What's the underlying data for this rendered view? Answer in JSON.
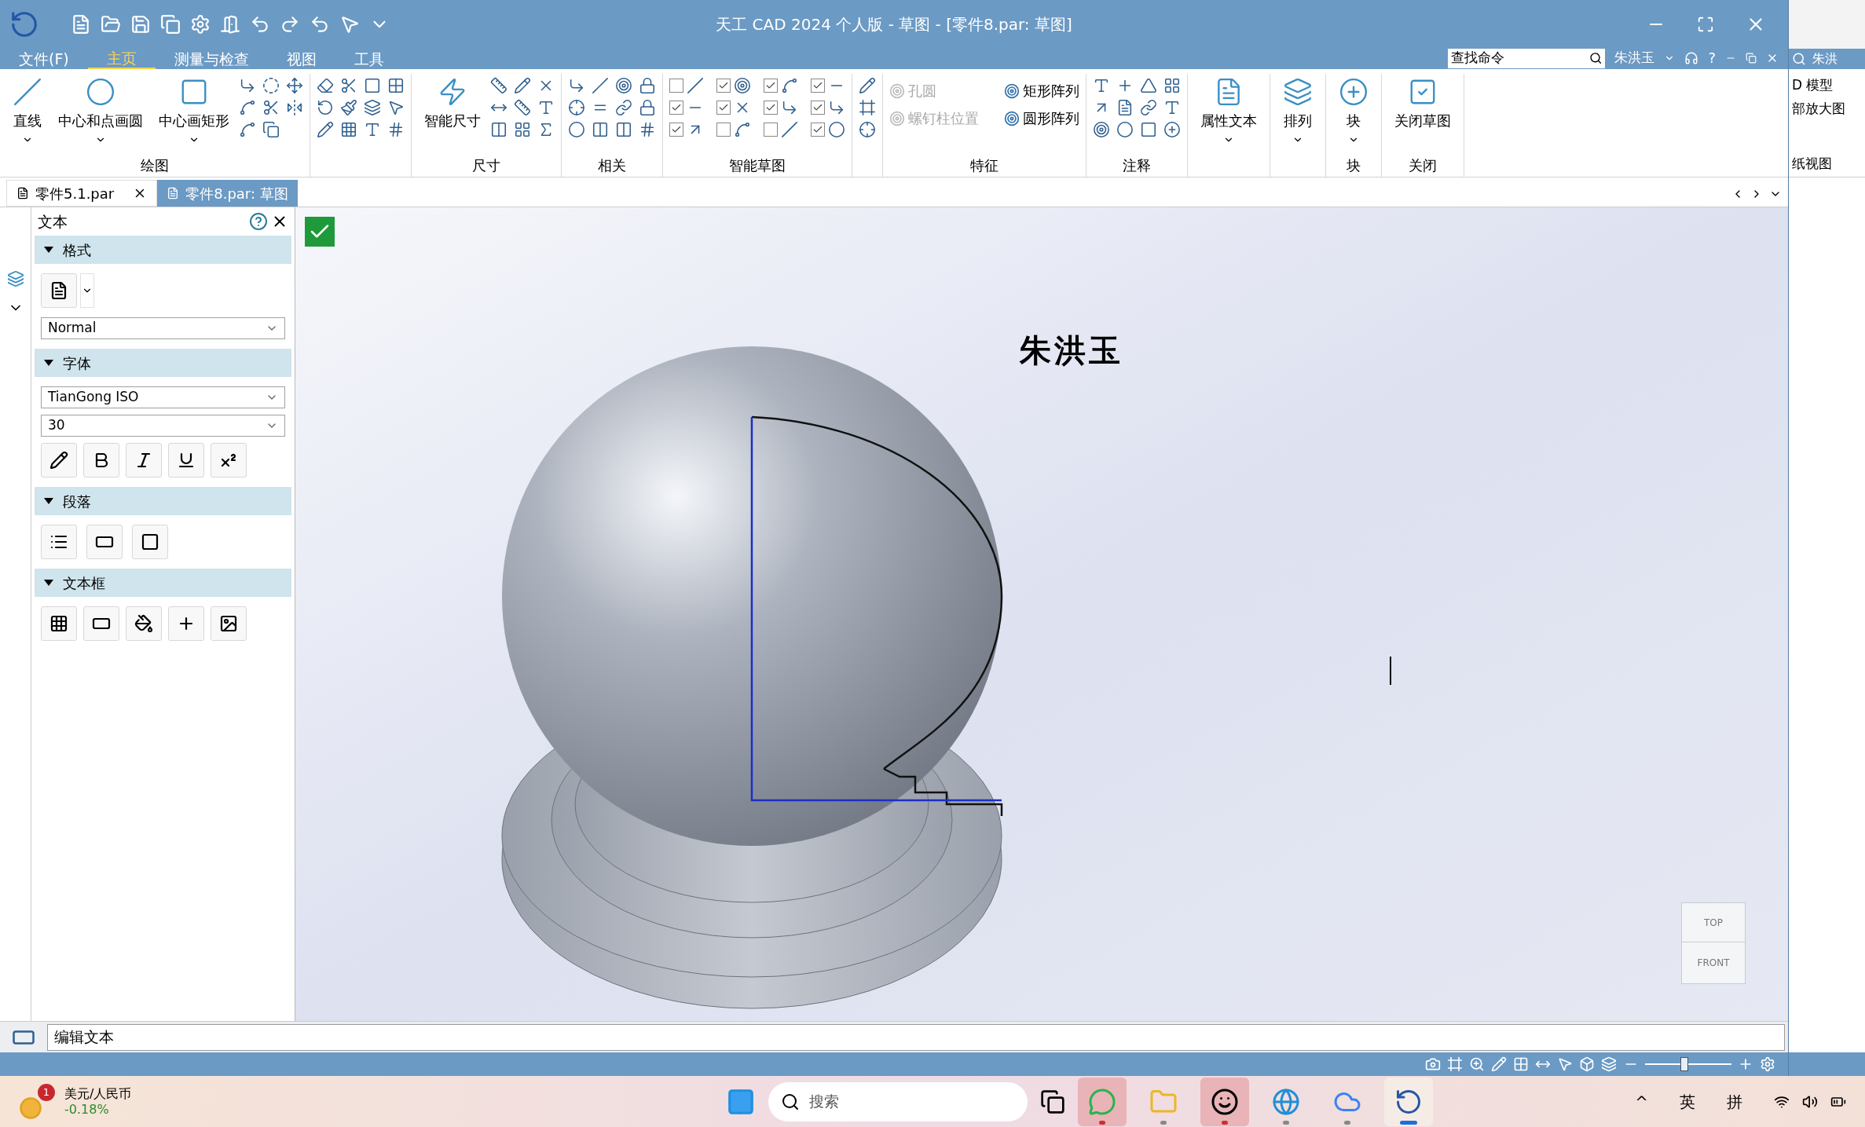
{
  "window": {
    "title": "天工 CAD 2024 个人版 - 草图 - [零件8.par: 草图]"
  },
  "menu_tabs": [
    {
      "label": "文件(F)",
      "selected": false
    },
    {
      "label": "主页",
      "selected": true
    },
    {
      "label": "测量与检查",
      "selected": false
    },
    {
      "label": "视图",
      "selected": false
    },
    {
      "label": "工具",
      "selected": false
    }
  ],
  "command_search": {
    "placeholder": "查找命令"
  },
  "user": "朱洪玉",
  "help": "?",
  "ribbon": {
    "groups": [
      {
        "kind": "tools",
        "label": "绘图",
        "buttons": [
          {
            "label": "直线",
            "dropdown": true
          },
          {
            "label": "中心和点画圆",
            "dropdown": true
          },
          {
            "label": "中心画矩形",
            "dropdown": true
          }
        ]
      },
      {
        "kind": "tools"
      },
      {
        "kind": "tools",
        "label": "尺寸",
        "buttons": [
          {
            "label": "智能尺寸",
            "dropdown": false
          }
        ]
      },
      {
        "kind": "tools",
        "label": "相关"
      },
      {
        "kind": "checks",
        "label": "智能草图",
        "checks": [
          {
            "checked": false
          },
          {
            "checked": true
          },
          {
            "checked": true
          },
          {
            "checked": true
          },
          {
            "checked": true
          },
          {
            "checked": false
          },
          {
            "checked": true
          },
          {
            "checked": true
          },
          {
            "checked": false
          },
          {
            "checked": true
          },
          {
            "checked": true
          },
          {
            "checked": true
          }
        ]
      },
      {
        "kind": "tools"
      },
      {
        "kind": "features",
        "label": "特征",
        "features": [
          {
            "label": "孔圆",
            "disabled": true
          },
          {
            "label": "螺钉柱位置",
            "disabled": true
          },
          {
            "label": "矩形阵列",
            "disabled": false
          },
          {
            "label": "圆形阵列",
            "disabled": false
          }
        ]
      },
      {
        "kind": "tools",
        "label": "注释"
      },
      {
        "kind": "tools",
        "buttons": [
          {
            "label": "属性文本",
            "dropdown": true
          }
        ]
      },
      {
        "kind": "tools",
        "buttons": [
          {
            "label": "排列",
            "dropdown": true
          }
        ]
      },
      {
        "kind": "tools",
        "label": "块",
        "buttons": [
          {
            "label": "块",
            "dropdown": true
          }
        ]
      },
      {
        "kind": "tools",
        "label": "关闭",
        "buttons": [
          {
            "label": "关闭草图",
            "dropdown": false
          }
        ]
      }
    ]
  },
  "doc_tabs": [
    {
      "label": "零件5.1.par",
      "selected": false,
      "closable": true
    },
    {
      "label": "零件8.par: 草图",
      "selected": true,
      "closable": false
    }
  ],
  "text_panel": {
    "title": "文本",
    "sections": [
      {
        "title": "格式",
        "expanded": true,
        "kind": "format",
        "style": "Normal"
      },
      {
        "title": "字体",
        "expanded": true,
        "kind": "font",
        "font": "TianGong ISO",
        "size": "30"
      },
      {
        "title": "段落",
        "expanded": true,
        "kind": "paragraph"
      },
      {
        "title": "文本框",
        "expanded": true,
        "kind": "textbox"
      }
    ]
  },
  "canvas": {
    "text": "朱洪玉",
    "view_cube": {
      "top": "TOP",
      "front": "FRONT"
    }
  },
  "command_line": {
    "value": "编辑文本"
  },
  "status_bar": {
    "zoom": {
      "level": 0.45
    }
  },
  "background_window": {
    "user": "朱洪",
    "ribbon_items": [
      "D 模型",
      "部放大图"
    ],
    "group_label": "纸视图"
  },
  "taskbar": {
    "widget": {
      "title": "美元/人民币",
      "change": "-0.18%",
      "badge": "1"
    },
    "search": {
      "placeholder": "搜索"
    },
    "apps": [
      {
        "kind": "chat",
        "attention": true,
        "selected": false
      },
      {
        "kind": "folder",
        "attention": false,
        "selected": false
      },
      {
        "kind": "penguin",
        "attention": true,
        "selected": false
      },
      {
        "kind": "browser",
        "attention": false,
        "selected": false
      },
      {
        "kind": "cloud",
        "attention": false,
        "selected": false
      },
      {
        "kind": "cad",
        "attention": false,
        "selected": true
      }
    ],
    "tray": {
      "chevron": "^",
      "lang": "英",
      "ime": "拼"
    }
  }
}
